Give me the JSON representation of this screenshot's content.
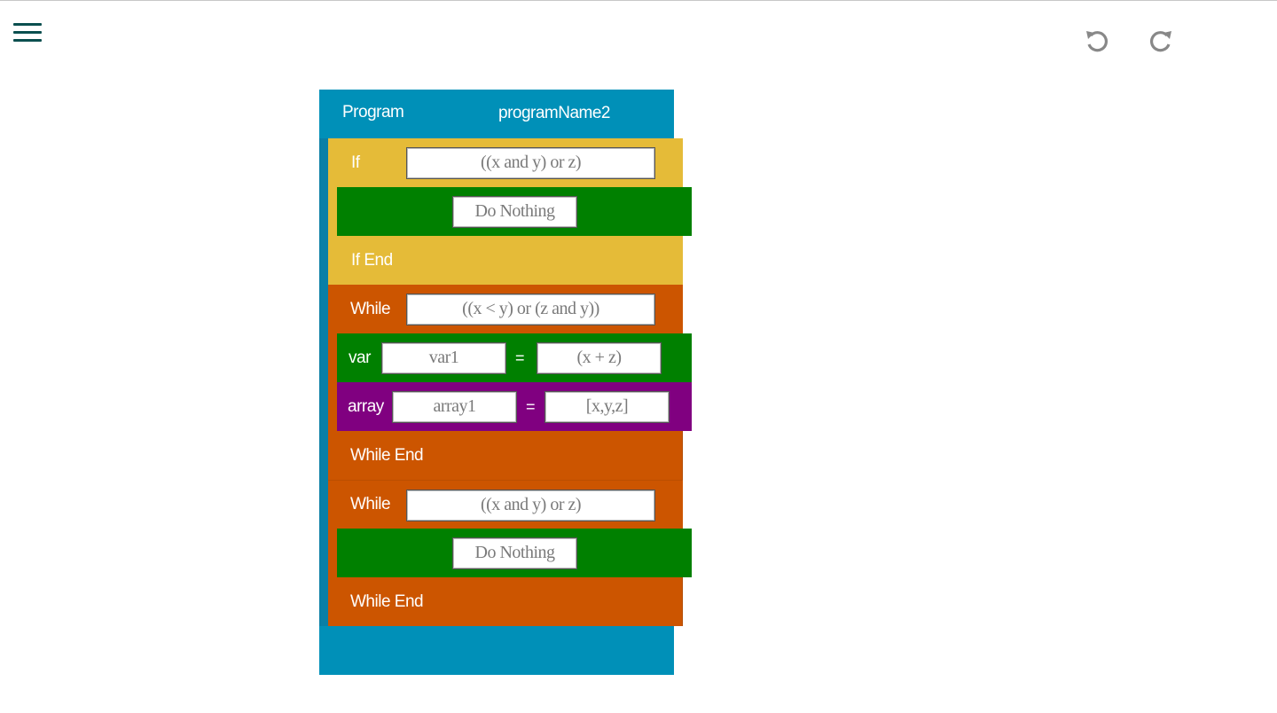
{
  "toolbar": {
    "menu_icon": "hamburger-menu-icon",
    "undo_icon": "undo-icon",
    "redo_icon": "redo-icon"
  },
  "program": {
    "label": "Program",
    "name": "programName2"
  },
  "blocks": {
    "if1": {
      "label": "If",
      "condition": "((x and y) or z)"
    },
    "if1_body": {
      "value": "Do Nothing"
    },
    "if1_end": {
      "label": "If End"
    },
    "while1": {
      "label": "While",
      "condition": "((x < y) or (z and y))"
    },
    "var1": {
      "label": "var",
      "name": "var1",
      "eq": "=",
      "value": "(x + z)"
    },
    "array1": {
      "label": "array",
      "name": "array1",
      "eq": "=",
      "value": "[x,y,z]"
    },
    "while1_end": {
      "label": "While End"
    },
    "while2": {
      "label": "While",
      "condition": "((x and y) or z)"
    },
    "while2_body": {
      "value": "Do Nothing"
    },
    "while2_end": {
      "label": "While End"
    }
  },
  "colors": {
    "program": "#0090b8",
    "if": "#e5bb38",
    "while": "#cc5500",
    "statement": "#008000",
    "array": "#800080",
    "menu": "#0b4f4f",
    "tool": "#888888"
  }
}
